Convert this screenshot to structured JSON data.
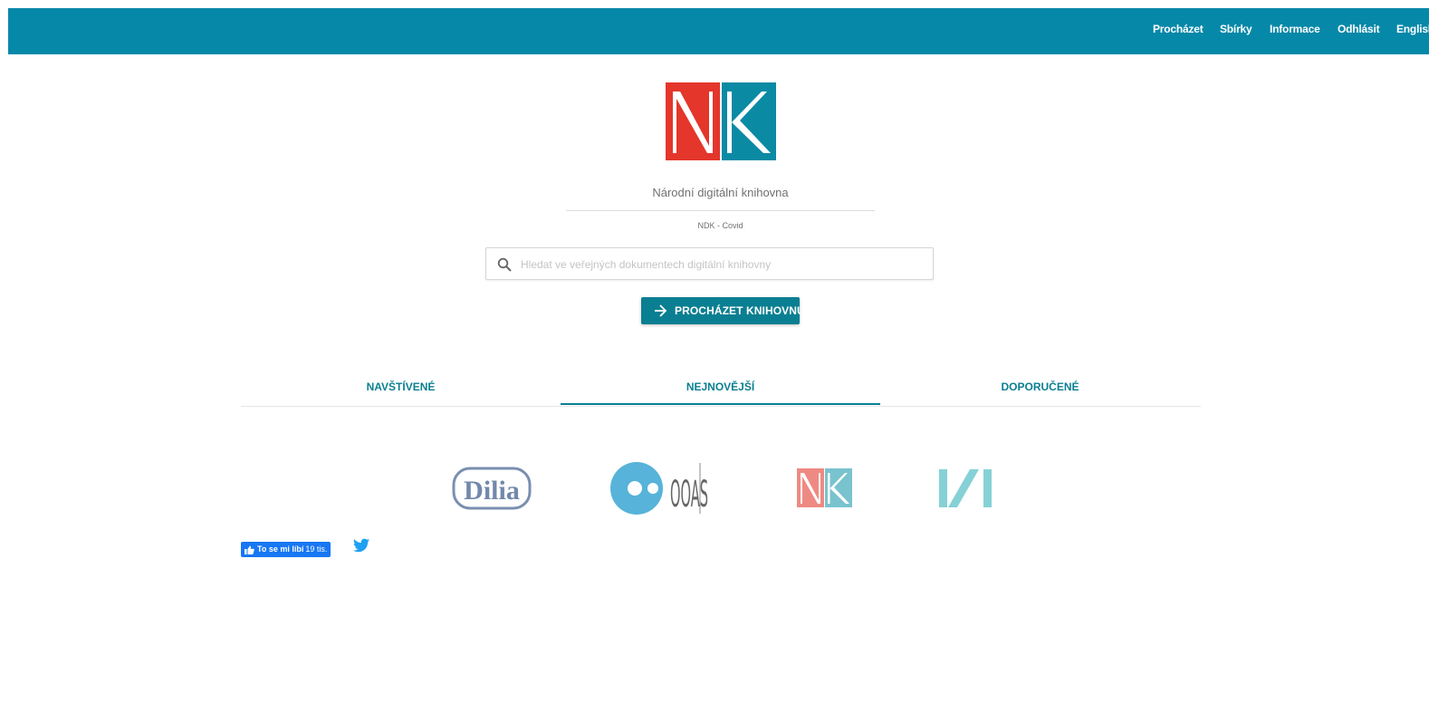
{
  "nav": {
    "items": [
      "Procházet",
      "Sbírky",
      "Informace",
      "Odhlásit"
    ],
    "language": "English"
  },
  "header": {
    "title": "Národní digitální knihovna",
    "subtitle": "NDK - Covid",
    "logo_letters": "NK"
  },
  "search": {
    "placeholder": "Hledat ve veřejných dokumentech digitální knihovny",
    "value": ""
  },
  "browse_button": {
    "label": "PROCHÁZET KNIHOVNU"
  },
  "tabs": [
    {
      "label": "NAVŠTÍVENÉ",
      "active": false
    },
    {
      "label": "NEJNOVĚJŠÍ",
      "active": true
    },
    {
      "label": "DOPORUČENÉ",
      "active": false
    }
  ],
  "collections": [
    {
      "name": "Dilia",
      "logo_text": "Dilia"
    },
    {
      "name": "OOAS",
      "logo_text": "OOAS"
    },
    {
      "name": "NK",
      "logo_text": "NK"
    },
    {
      "name": "IVI",
      "logo_text": "I/I"
    }
  ],
  "social": {
    "facebook_label": "To se mi líbí",
    "facebook_count": "19 tis.",
    "twitter_icon": "twitter-bird-icon"
  },
  "colors": {
    "header_bg": "#0688a8",
    "accent": "#0a7f92",
    "nk_red": "#e4362b",
    "nk_teal": "#0b8aa4",
    "facebook_blue": "#1877f2",
    "twitter_blue": "#1da1f2"
  }
}
